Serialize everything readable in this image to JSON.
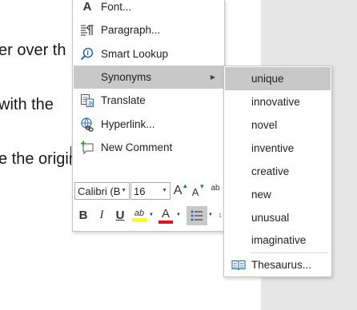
{
  "document": {
    "lines": [
      "er over th",
      "with the",
      "e the original"
    ]
  },
  "context_menu": {
    "items": [
      {
        "label": "Font...",
        "icon": "font-icon"
      },
      {
        "label": "Paragraph...",
        "icon": "paragraph-icon"
      },
      {
        "label": "Smart Lookup",
        "icon": "smart-lookup-icon"
      },
      {
        "label": "Synonyms",
        "icon": "",
        "has_submenu": true
      },
      {
        "label": "Translate",
        "icon": "translate-icon"
      },
      {
        "label": "Hyperlink...",
        "icon": "hyperlink-icon"
      },
      {
        "label": "New Comment",
        "icon": "new-comment-icon"
      }
    ]
  },
  "mini_toolbar": {
    "font_name": "Calibri (B",
    "font_size": "16",
    "grow_font_label": "A",
    "shrink_font_label": "A",
    "bold_label": "B",
    "italic_label": "I",
    "underline_label": "U",
    "highlight_label": "ab",
    "font_color_label": "A",
    "highlight_color": "#ffff00",
    "font_color": "#e81123"
  },
  "synonyms_submenu": {
    "items": [
      "unique",
      "innovative",
      "novel",
      "inventive",
      "creative",
      "new",
      "unusual",
      "imaginative"
    ],
    "thesaurus_label": "Thesaurus..."
  }
}
